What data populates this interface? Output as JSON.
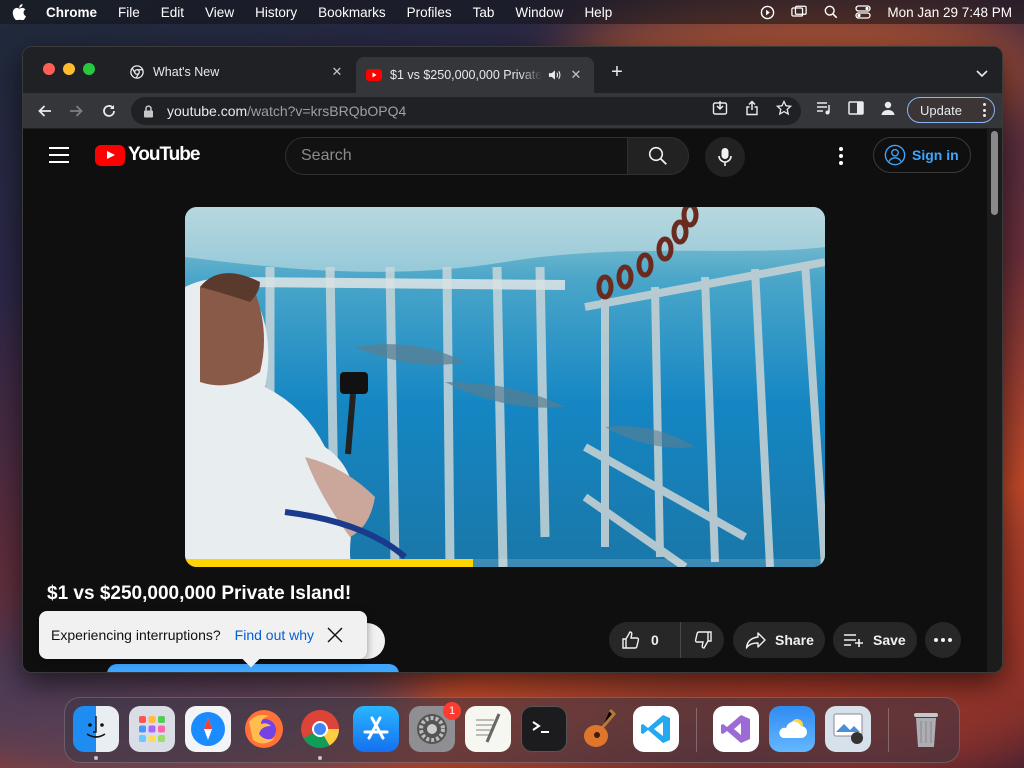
{
  "menubar": {
    "app_name": "Chrome",
    "items": [
      "File",
      "Edit",
      "View",
      "History",
      "Bookmarks",
      "Profiles",
      "Tab",
      "Window",
      "Help"
    ],
    "clock": "Mon Jan 29  7:48 PM"
  },
  "browser": {
    "tabs": [
      {
        "title": "What's New",
        "active": false
      },
      {
        "title": "$1 vs $250,000,000 Private Island!",
        "active": true,
        "audio": true
      }
    ],
    "address": {
      "host": "youtube.com",
      "path": "/watch?v=krsBRQbOPQ4"
    },
    "update_label": "Update"
  },
  "youtube": {
    "logo_text": "YouTube",
    "search_placeholder": "Search",
    "signin_label": "Sign in",
    "video": {
      "title": "$1 vs $250,000,000 Private Island!",
      "progress_fraction": 0.45
    },
    "actions": {
      "like_count": "0",
      "share_label": "Share",
      "save_label": "Save"
    },
    "toast": {
      "message": "Experiencing interruptions?",
      "link": "Find out why"
    }
  },
  "dock": {
    "badge_count": "1",
    "apps": [
      "finder",
      "launchpad",
      "safari",
      "firefox",
      "chrome",
      "app-store",
      "system-settings",
      "textedit",
      "terminal",
      "garageband",
      "vscode",
      "visual-studio",
      "weather",
      "preview",
      "trash"
    ]
  },
  "colors": {
    "yt_red": "#ff0000",
    "progress_yellow": "#ffd400",
    "link_blue": "#3ea6ff",
    "toast_link": "#065fd4"
  }
}
